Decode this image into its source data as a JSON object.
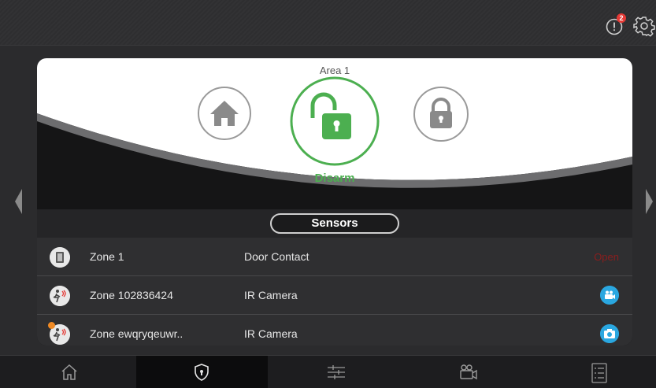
{
  "topbar": {
    "alert_count": "2",
    "icons": [
      "alert-icon",
      "settings-gear-icon"
    ]
  },
  "hero": {
    "area_title": "Area 1",
    "modes": [
      "home-stay-icon",
      "disarm-unlock-icon",
      "away-lock-icon"
    ],
    "selected_mode_label": "Disarm",
    "colors": {
      "active": "#4caf50",
      "inactive": "#8a8a8a"
    }
  },
  "sensors": {
    "header": "Sensors",
    "rows": [
      {
        "name": "Zone 1",
        "type": "Door Contact",
        "status": "Open",
        "icon": "door-contact-icon"
      },
      {
        "name": "Zone 102836424",
        "type": "IR Camera",
        "action_icon": "video-camera-icon",
        "icon": "motion-sensor-icon"
      },
      {
        "name": "Zone ewqryqeuwr..",
        "type": "IR Camera",
        "action_icon": "photo-camera-icon",
        "icon": "motion-sensor-icon"
      }
    ],
    "colors": {
      "open_status": "#8b1e1e",
      "camera_button": "#2aa7e0"
    }
  },
  "bottom_nav": {
    "tabs": [
      "home-icon",
      "security-shield-icon",
      "controls-sliders-icon",
      "video-camera-icon",
      "list-icon"
    ],
    "active_tab": "security-shield-icon"
  }
}
